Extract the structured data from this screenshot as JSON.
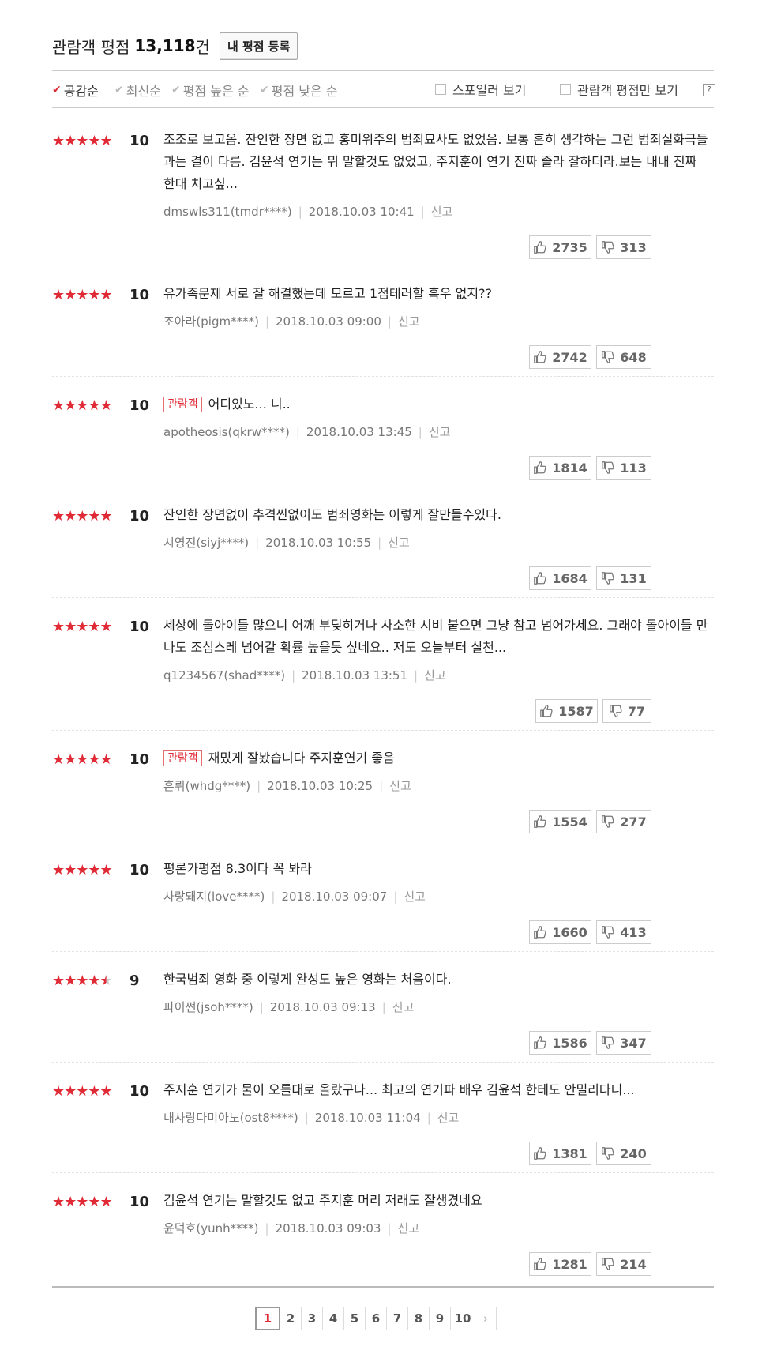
{
  "header": {
    "label": "관람객 평점",
    "count": "13,118",
    "unit": "건",
    "write_button": "내 평점 등록"
  },
  "sort": {
    "items": [
      {
        "label": "공감순",
        "active": true
      },
      {
        "label": "최신순",
        "active": false
      },
      {
        "label": "평점 높은 순",
        "active": false
      },
      {
        "label": "평점 낮은 순",
        "active": false
      }
    ],
    "options": [
      "스포일러 보기",
      "관람객 평점만 보기"
    ],
    "help": "?"
  },
  "reviews": [
    {
      "rating": 10,
      "stars": 5,
      "badge": "",
      "text": "조조로 보고옴. 잔인한 장면 없고 홍미위주의 범죄묘사도 없었음. 보통 흔히 생각하는 그런 범죄실화극들과는 결이 다름. 김윤석 연기는 뭐 말할것도 없었고, 주지훈이 연기 진짜 졸라 잘하더라.보는 내내 진짜 한대 치고싶...",
      "user": "dmswls311(tmdr****)",
      "date": "2018.10.03 10:41",
      "report": "신고",
      "up": "2735",
      "down": "313"
    },
    {
      "rating": 10,
      "stars": 5,
      "badge": "",
      "text": "유가족문제 서로 잘 해결했는데 모르고 1점테러할 흑우 없지??",
      "user": "조아라(pigm****)",
      "date": "2018.10.03 09:00",
      "report": "신고",
      "up": "2742",
      "down": "648"
    },
    {
      "rating": 10,
      "stars": 5,
      "badge": "관람객",
      "text": "어디있노... 니..",
      "user": "apotheosis(qkrw****)",
      "date": "2018.10.03 13:45",
      "report": "신고",
      "up": "1814",
      "down": "113"
    },
    {
      "rating": 10,
      "stars": 5,
      "badge": "",
      "text": "잔인한 장면없이 추격씬없이도 범죄영화는 이렇게 잘만들수있다.",
      "user": "시영진(siyj****)",
      "date": "2018.10.03 10:55",
      "report": "신고",
      "up": "1684",
      "down": "131"
    },
    {
      "rating": 10,
      "stars": 5,
      "badge": "",
      "text": "세상에 돌아이들 많으니 어깨 부딪히거나 사소한 시비 붙으면 그냥 참고 넘어가세요. 그래야 돌아이들 만나도 조심스레 넘어갈 확률 높을듯 싶네요.. 저도 오늘부터 실천...",
      "user": "q1234567(shad****)",
      "date": "2018.10.03 13:51",
      "report": "신고",
      "up": "1587",
      "down": "77"
    },
    {
      "rating": 10,
      "stars": 5,
      "badge": "관람객",
      "text": "재밌게 잘봤습니다 주지훈연기 좋음",
      "user": "흔뤼(whdg****)",
      "date": "2018.10.03 10:25",
      "report": "신고",
      "up": "1554",
      "down": "277"
    },
    {
      "rating": 10,
      "stars": 5,
      "badge": "",
      "text": "평론가평점 8.3이다 꼭 봐라",
      "user": "사랑돼지(love****)",
      "date": "2018.10.03 09:07",
      "report": "신고",
      "up": "1660",
      "down": "413"
    },
    {
      "rating": 9,
      "stars": 4.5,
      "badge": "",
      "text": "한국범죄 영화 중 이렇게 완성도 높은 영화는 처음이다.",
      "user": "파이썬(jsoh****)",
      "date": "2018.10.03 09:13",
      "report": "신고",
      "up": "1586",
      "down": "347"
    },
    {
      "rating": 10,
      "stars": 5,
      "badge": "",
      "text": "주지훈 연기가 물이 오를대로 올랐구나... 최고의 연기파 배우 김윤석 한테도 안밀리다니...",
      "user": "내사랑다미아노(ost8****)",
      "date": "2018.10.03 11:04",
      "report": "신고",
      "up": "1381",
      "down": "240"
    },
    {
      "rating": 10,
      "stars": 5,
      "badge": "",
      "text": "김윤석 연기는 말할것도 없고 주지훈 머리 저래도 잘생겼네요",
      "user": "윤덕호(yunh****)",
      "date": "2018.10.03 09:03",
      "report": "신고",
      "up": "1281",
      "down": "214"
    }
  ],
  "pagination": {
    "pages": [
      "1",
      "2",
      "3",
      "4",
      "5",
      "6",
      "7",
      "8",
      "9",
      "10"
    ],
    "current": "1",
    "next": "›"
  },
  "colors": {
    "accent": "#e02a36",
    "border": "#cccccc"
  }
}
